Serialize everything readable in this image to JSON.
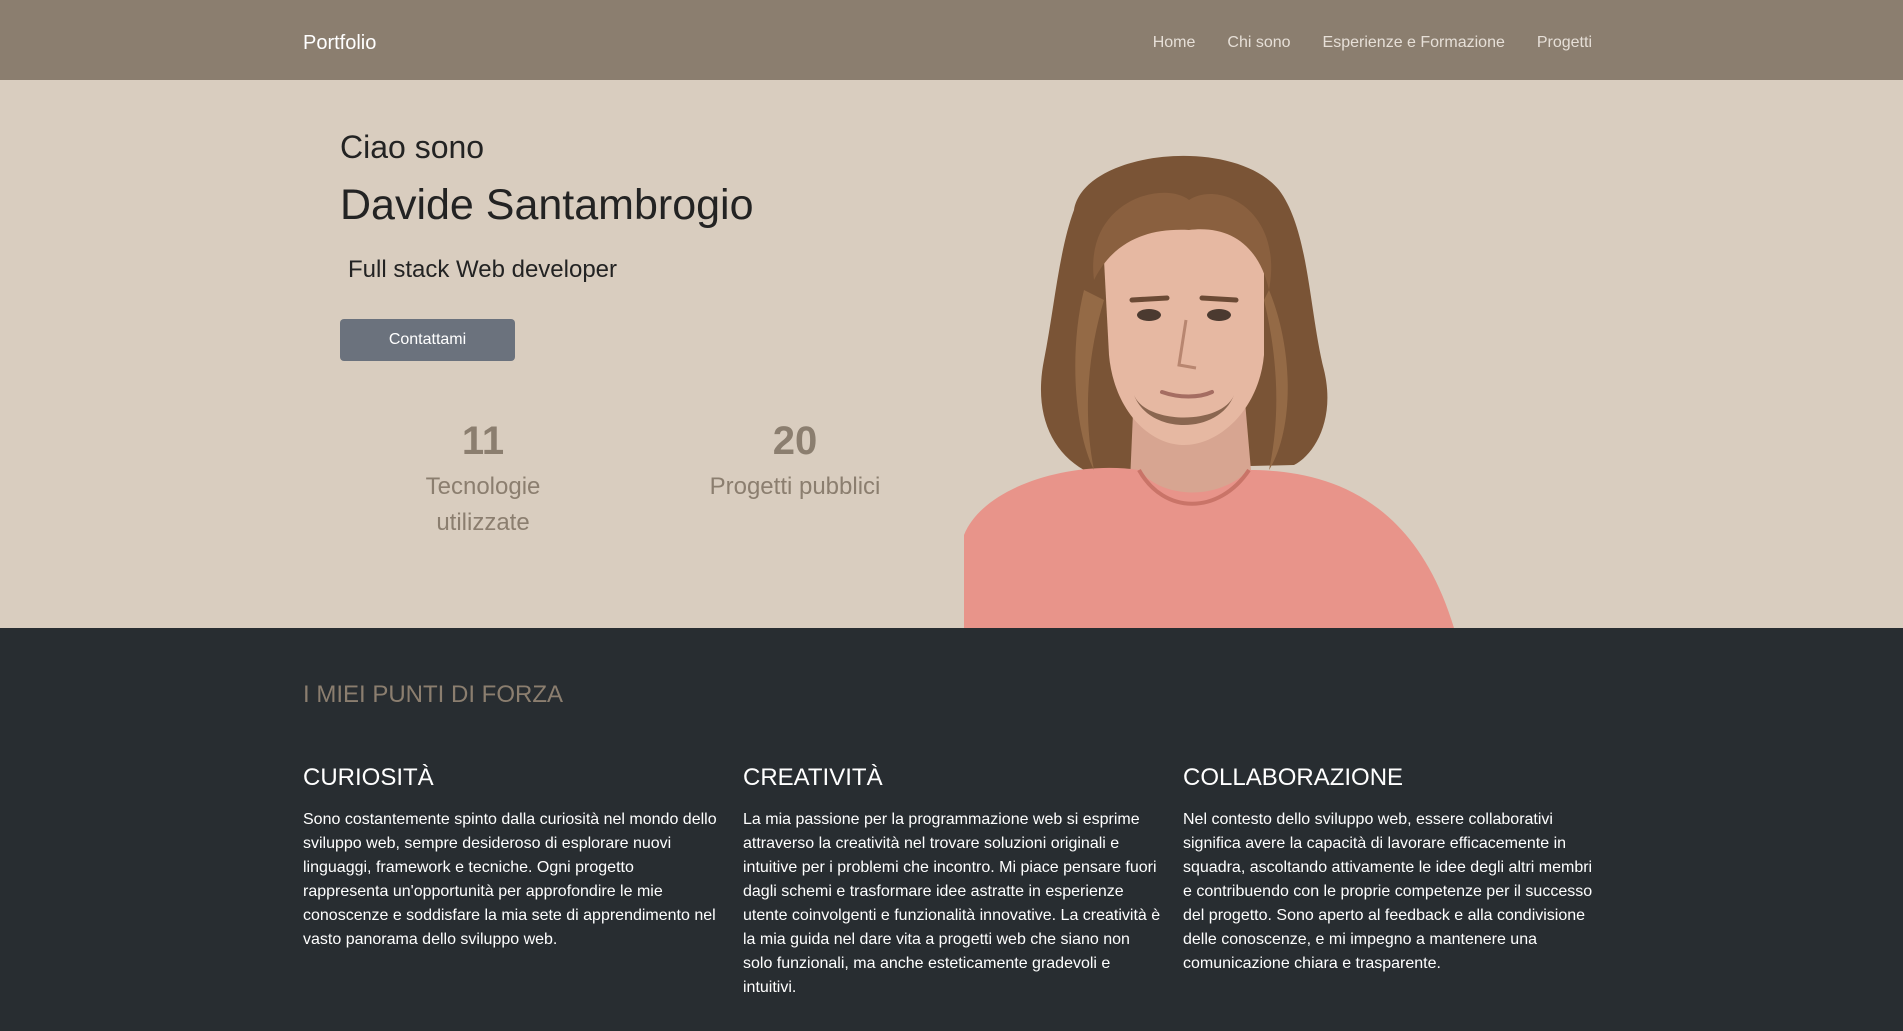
{
  "navbar": {
    "brand": "Portfolio",
    "links": [
      "Home",
      "Chi sono",
      "Esperienze e Formazione",
      "Progetti"
    ]
  },
  "hero": {
    "greeting": "Ciao sono",
    "name": "Davide Santambrogio",
    "role": "Full stack Web developer",
    "cta_label": "Contattami",
    "stats": [
      {
        "value": "11",
        "label": "Tecnologie utilizzate"
      },
      {
        "value": "20",
        "label": "Progetti pubblici"
      }
    ]
  },
  "strengths": {
    "title": "I MIEI PUNTI DI FORZA",
    "items": [
      {
        "heading": "CURIOSITÀ",
        "text": "Sono costantemente spinto dalla curiosità nel mondo dello sviluppo web, sempre desideroso di esplorare nuovi linguaggi, framework e tecniche. Ogni progetto rappresenta un'opportunità per approfondire le mie conoscenze e soddisfare la mia sete di apprendimento nel vasto panorama dello sviluppo web."
      },
      {
        "heading": "CREATIVITÀ",
        "text": "La mia passione per la programmazione web si esprime attraverso la creatività nel trovare soluzioni originali e intuitive per i problemi che incontro. Mi piace pensare fuori dagli schemi e trasformare idee astratte in esperienze utente coinvolgenti e funzionalità innovative. La creatività è la mia guida nel dare vita a progetti web che siano non solo funzionali, ma anche esteticamente gradevoli e intuitivi."
      },
      {
        "heading": "COLLABORAZIONE",
        "text": "Nel contesto dello sviluppo web, essere collaborativi significa avere la capacità di lavorare efficacemente in squadra, ascoltando attivamente le idee degli altri membri e contribuendo con le proprie competenze per il successo del progetto. Sono aperto al feedback e alla condivisione delle conoscenze, e mi impegno a mantenere una comunicazione chiara e trasparente."
      }
    ]
  },
  "colors": {
    "navbar": "#8b7e6f",
    "hero": "#d9cdbf",
    "dark_section": "#282d31",
    "button": "#6b727d"
  }
}
